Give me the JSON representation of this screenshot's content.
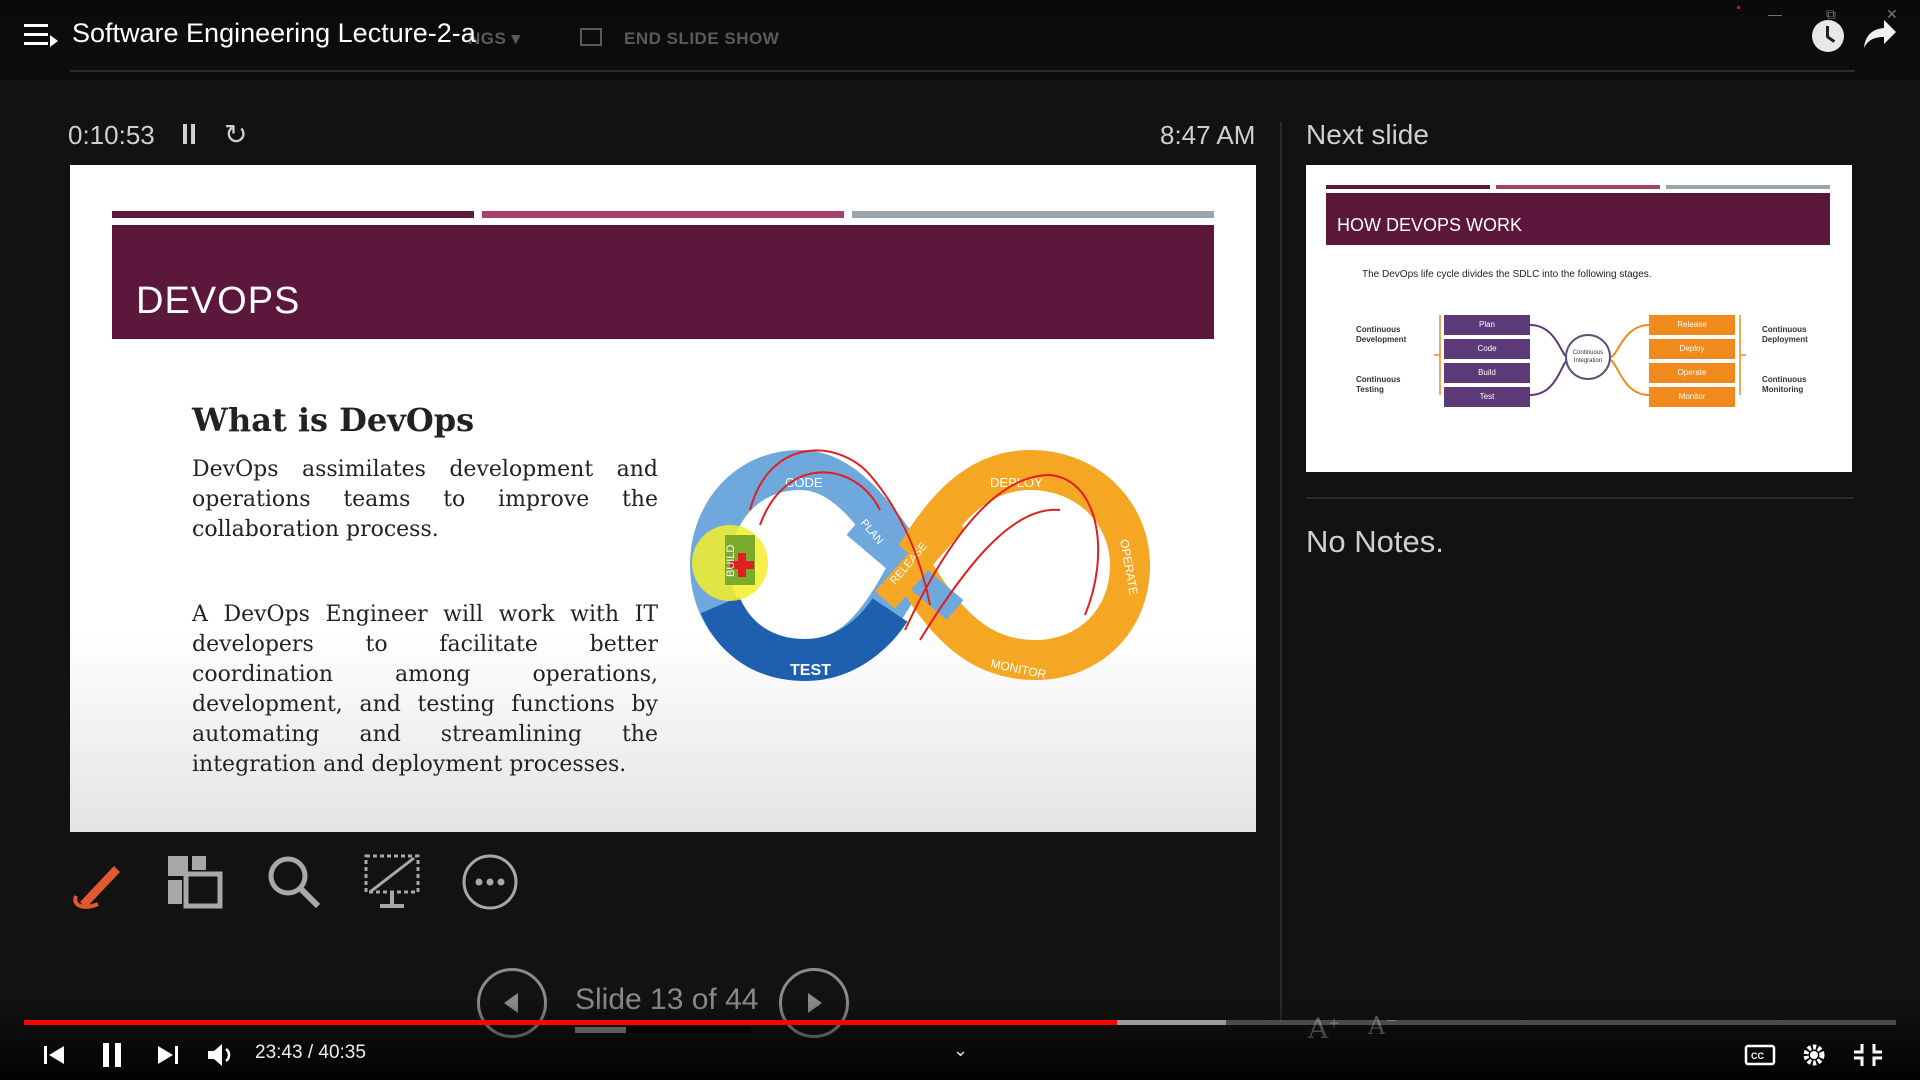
{
  "window": {
    "title": "Software Engineering Lecture-2-a",
    "ghost_settings": "NGS ▾",
    "ghost_end_show": "END SLIDE SHOW",
    "win_min": "—",
    "win_max": "⧉",
    "win_close": "✕"
  },
  "presenter": {
    "timer": "0:10:53",
    "clock": "8:47 AM",
    "next_slide_label": "Next slide",
    "notes": "No Notes.",
    "slide_counter": "Slide 13 of 44",
    "slide_progress_fraction": 0.29
  },
  "current_slide": {
    "title": "DEVOPS",
    "heading": "What is DevOps",
    "paragraph1": "DevOps assimilates development and operations teams to improve the collaboration process.",
    "paragraph2": "A DevOps Engineer will work with IT developers to facilitate better coordination among operations, development, and testing functions by automating and streamlining the integration and deployment processes.",
    "diagram_labels": {
      "code": "CODE",
      "build": "BUILD",
      "plan": "PLAN",
      "test": "TEST",
      "release": "RELEASE",
      "deploy": "DEPLOY",
      "operate": "OPERATE",
      "monitor": "MONITOR"
    },
    "colors": {
      "banner": "#5c183c",
      "blue": "#1f5fb0",
      "light_blue": "#6fa8dc",
      "orange": "#f5a623",
      "annotation": "#e02020"
    }
  },
  "next_slide": {
    "title": "HOW DEVOPS WORK",
    "intro": "The DevOps life cycle divides the SDLC into the following stages.",
    "left_stages": [
      "Plan",
      "Code",
      "Build",
      "Test"
    ],
    "right_stages": [
      "Release",
      "Deploy",
      "Operate",
      "Monitor"
    ],
    "hub": "Continuous Integration",
    "labels": {
      "dev": "Continuous Development",
      "test": "Continuous Testing",
      "deploy": "Continuous Deployment",
      "monitor": "Continuous Monitoring"
    }
  },
  "player": {
    "time": "23:43 / 40:35",
    "played_fraction": 0.584,
    "buffered_fraction": 0.642,
    "accent": "#ff0000"
  },
  "font_controls": {
    "increase": "A",
    "decrease": "A"
  }
}
